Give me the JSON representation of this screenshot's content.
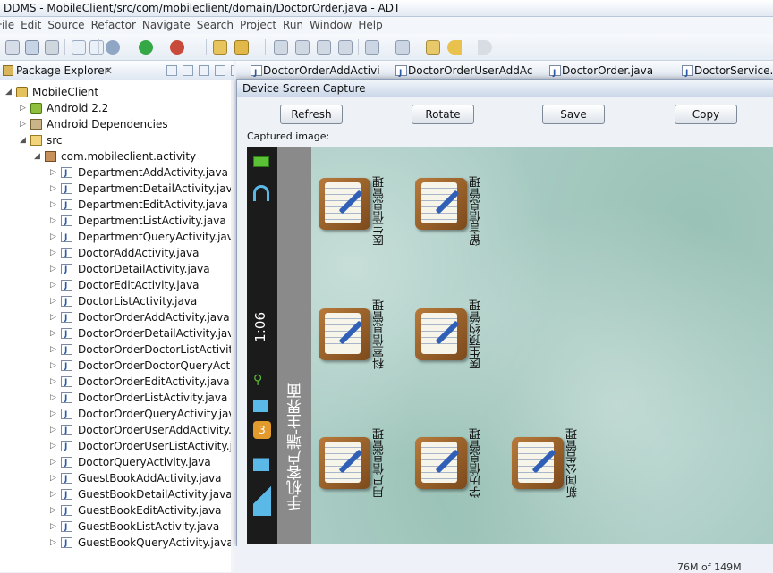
{
  "window": {
    "title": "DDMS - MobileClient/src/com/mobileclient/domain/DoctorOrder.java - ADT"
  },
  "menu": [
    "File",
    "Edit",
    "Source",
    "Refactor",
    "Navigate",
    "Search",
    "Project",
    "Run",
    "Window",
    "Help"
  ],
  "package_explorer": {
    "title": "Package Explorer",
    "close": "✕",
    "tree": [
      {
        "label": "MobileClient",
        "level": 0,
        "icon": "project-icon"
      },
      {
        "label": "Android 2.2",
        "level": 1,
        "icon": "android-lib-icon"
      },
      {
        "label": "Android Dependencies",
        "level": 1,
        "icon": "library-icon"
      },
      {
        "label": "src",
        "level": 1,
        "icon": "source-folder-icon"
      },
      {
        "label": "com.mobileclient.activity",
        "level": 2,
        "icon": "package-icon"
      },
      {
        "label": "DepartmentAddActivity.java",
        "level": 3,
        "icon": "java-file-icon"
      },
      {
        "label": "DepartmentDetailActivity.java",
        "level": 3,
        "icon": "java-file-icon"
      },
      {
        "label": "DepartmentEditActivity.java",
        "level": 3,
        "icon": "java-file-icon"
      },
      {
        "label": "DepartmentListActivity.java",
        "level": 3,
        "icon": "java-file-icon"
      },
      {
        "label": "DepartmentQueryActivity.java",
        "level": 3,
        "icon": "java-file-icon"
      },
      {
        "label": "DoctorAddActivity.java",
        "level": 3,
        "icon": "java-file-icon"
      },
      {
        "label": "DoctorDetailActivity.java",
        "level": 3,
        "icon": "java-file-icon"
      },
      {
        "label": "DoctorEditActivity.java",
        "level": 3,
        "icon": "java-file-icon"
      },
      {
        "label": "DoctorListActivity.java",
        "level": 3,
        "icon": "java-file-icon"
      },
      {
        "label": "DoctorOrderAddActivity.java",
        "level": 3,
        "icon": "java-file-icon"
      },
      {
        "label": "DoctorOrderDetailActivity.java",
        "level": 3,
        "icon": "java-file-icon"
      },
      {
        "label": "DoctorOrderDoctorListActivity.ja",
        "level": 3,
        "icon": "java-file-icon"
      },
      {
        "label": "DoctorOrderDoctorQueryActivit",
        "level": 3,
        "icon": "java-file-icon"
      },
      {
        "label": "DoctorOrderEditActivity.java",
        "level": 3,
        "icon": "java-file-icon"
      },
      {
        "label": "DoctorOrderListActivity.java",
        "level": 3,
        "icon": "java-file-icon"
      },
      {
        "label": "DoctorOrderQueryActivity.java",
        "level": 3,
        "icon": "java-file-icon"
      },
      {
        "label": "DoctorOrderUserAddActivity.jav",
        "level": 3,
        "icon": "java-file-icon"
      },
      {
        "label": "DoctorOrderUserListActivity.java",
        "level": 3,
        "icon": "java-file-icon"
      },
      {
        "label": "DoctorQueryActivity.java",
        "level": 3,
        "icon": "java-file-icon"
      },
      {
        "label": "GuestBookAddActivity.java",
        "level": 3,
        "icon": "java-file-icon"
      },
      {
        "label": "GuestBookDetailActivity.java",
        "level": 3,
        "icon": "java-file-icon"
      },
      {
        "label": "GuestBookEditActivity.java",
        "level": 3,
        "icon": "java-file-icon"
      },
      {
        "label": "GuestBookListActivity.java",
        "level": 3,
        "icon": "java-file-icon"
      },
      {
        "label": "GuestBookQueryActivity.java",
        "level": 3,
        "icon": "java-file-icon"
      }
    ]
  },
  "editor_tabs": [
    "DoctorOrderAddActivi",
    "DoctorOrderUserAddAc",
    "DoctorOrder.java",
    "DoctorService.ja"
  ],
  "dialog": {
    "title": "Device Screen Capture",
    "buttons": {
      "refresh": "Refresh",
      "rotate": "Rotate",
      "save": "Save",
      "copy": "Copy"
    },
    "captured_label": "Captured image:"
  },
  "device": {
    "time": "1:06",
    "app_title": "手机客户端-主界面",
    "notification_count": "3",
    "apps": [
      "医生信息管理",
      "留言信息管理",
      "科室信息管理",
      "医生预约管理",
      "用户信息管理",
      "学历信息管理",
      "新闻公告管理"
    ]
  },
  "status": {
    "memory": "76M of 149M"
  }
}
